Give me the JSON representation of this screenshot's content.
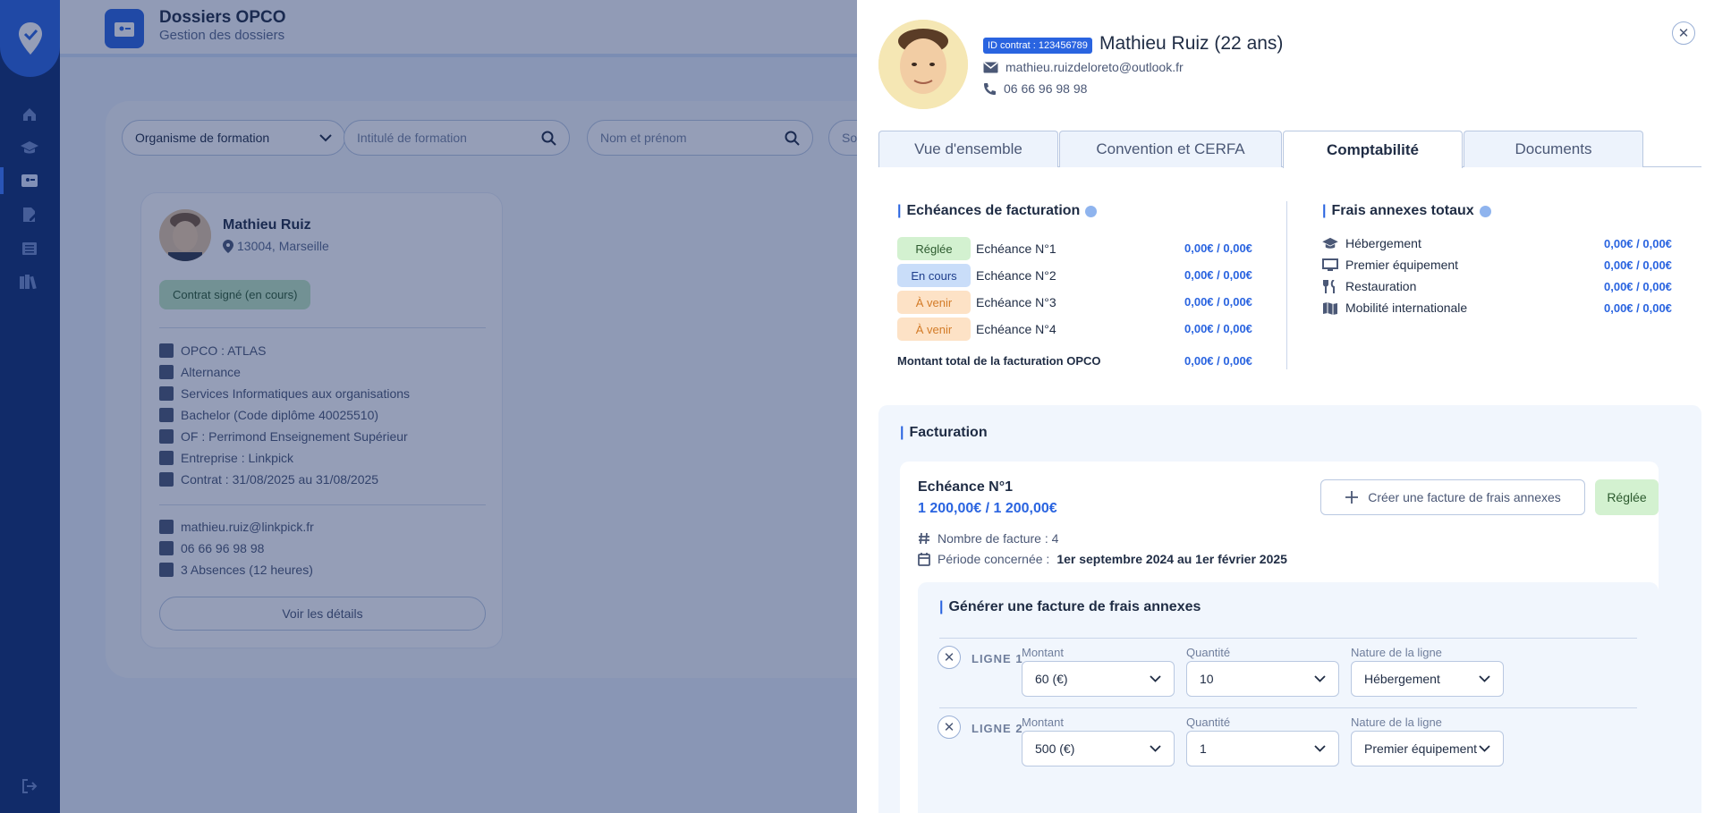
{
  "header": {
    "title": "Dossiers OPCO",
    "subtitle": "Gestion des dossiers"
  },
  "filters": {
    "organisme": "Organisme de formation",
    "intitule": "Intitulé de formation",
    "nom": "Nom et prénom",
    "truncated": "So"
  },
  "learner_card": {
    "name": "Mathieu Ruiz",
    "location": "13004, Marseille",
    "status": "Contrat signé (en cours)",
    "info": [
      "OPCO : ATLAS",
      "Alternance",
      "Services Informatiques aux organisations",
      "Bachelor (Code diplôme 40025510)",
      "OF : Perrimond Enseignement Supérieur",
      "Entreprise : Linkpick",
      "Contrat : 31/08/2025 au 31/08/2025"
    ],
    "email": "mathieu.ruiz@linkpick.fr",
    "phone": "06 66 96 98 98",
    "absences": "3 Absences (12 heures)",
    "details_button": "Voir les détails"
  },
  "panel": {
    "contract_id": "ID contrat : 123456789",
    "name": "Mathieu Ruiz (22 ans)",
    "email": "mathieu.ruizdeloreto@outlook.fr",
    "phone": "06 66 96 98 98",
    "tabs": [
      "Vue d'ensemble",
      "Convention et CERFA",
      "Comptabilité",
      "Documents"
    ],
    "echeances": {
      "title": "Echéances de facturation",
      "rows": [
        {
          "status": "Réglée",
          "label": "Echéance N°1",
          "amount": "0,00€ / 0,00€"
        },
        {
          "status": "En cours",
          "label": "Echéance N°2",
          "amount": "0,00€ / 0,00€"
        },
        {
          "status": "À venir",
          "label": "Echéance N°3",
          "amount": "0,00€ / 0,00€"
        },
        {
          "status": "À venir",
          "label": "Echéance N°4",
          "amount": "0,00€ / 0,00€"
        }
      ],
      "total_label": "Montant total de la facturation OPCO",
      "total_amount": "0,00€ / 0,00€"
    },
    "frais": {
      "title": "Frais annexes totaux",
      "rows": [
        {
          "label": "Hébergement",
          "amount": "0,00€ / 0,00€"
        },
        {
          "label": "Premier équipement",
          "amount": "0,00€ / 0,00€"
        },
        {
          "label": "Restauration",
          "amount": "0,00€ / 0,00€"
        },
        {
          "label": "Mobilité internationale",
          "amount": "0,00€ / 0,00€"
        }
      ]
    },
    "facturation": {
      "title": "Facturation",
      "echeance_title": "Echéance N°1",
      "echeance_amount": "1 200,00€ / 1 200,00€",
      "nb_factures": "Nombre de facture : 4",
      "periode_label": "Période concernée :",
      "periode_value": "1er septembre 2024 au 1er février 2025",
      "create_button": "Créer une facture de frais annexes",
      "status": "Réglée",
      "generer": {
        "title": "Générer une facture de frais annexes",
        "col_montant": "Montant",
        "col_quantite": "Quantité",
        "col_nature": "Nature de la ligne",
        "lines": [
          {
            "label": "LIGNE 1",
            "montant": "60 (€)",
            "quantite": "10",
            "nature": "Hébergement"
          },
          {
            "label": "LIGNE 2",
            "montant": "500 (€)",
            "quantite": "1",
            "nature": "Premier équipement"
          }
        ]
      }
    }
  }
}
